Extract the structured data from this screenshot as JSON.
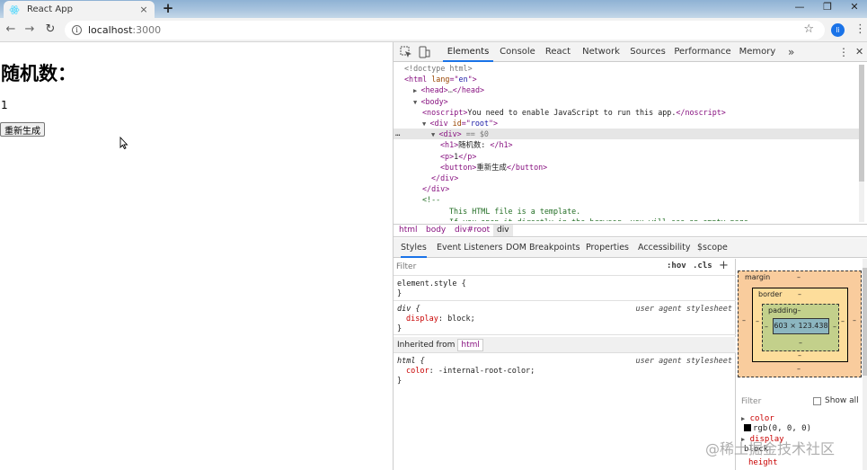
{
  "browser": {
    "tab_title": "React App",
    "tab_close": "×",
    "new_tab": "+",
    "url_host": "localhost",
    "url_port": ":3000",
    "profile_initial": "li",
    "window_controls": [
      "—",
      "❐",
      "✕"
    ],
    "nav": {
      "back": "←",
      "forward": "→",
      "reload": "↻"
    }
  },
  "page": {
    "heading": "随机数：",
    "number": "1",
    "button_label": "重新生成"
  },
  "devtools": {
    "tabs": [
      "Elements",
      "Console",
      "React",
      "Network",
      "Sources",
      "Performance",
      "Memory"
    ],
    "active_tab": "Elements",
    "more": "»",
    "menu": "⋮",
    "close": "✕",
    "dom": [
      {
        "indent": 0,
        "tri": "",
        "parts": [
          [
            "gray",
            "<!doctype html>"
          ]
        ]
      },
      {
        "indent": 0,
        "tri": "",
        "parts": [
          [
            "tag",
            "<html "
          ],
          [
            "attr",
            "lang"
          ],
          [
            "tag",
            "=\""
          ],
          [
            "val",
            "en"
          ],
          [
            "tag",
            "\">"
          ]
        ]
      },
      {
        "indent": 1,
        "tri": "▶",
        "parts": [
          [
            "tag",
            "<head>"
          ],
          [
            "gray",
            "…"
          ],
          [
            "tag",
            "</head>"
          ]
        ]
      },
      {
        "indent": 1,
        "tri": "▼",
        "parts": [
          [
            "tag",
            "<body>"
          ]
        ]
      },
      {
        "indent": 2,
        "tri": "",
        "parts": [
          [
            "tag",
            "<noscript>"
          ],
          [
            "txt",
            "You need to enable JavaScript to run this app."
          ],
          [
            "tag",
            "</noscript>"
          ]
        ]
      },
      {
        "indent": 2,
        "tri": "▼",
        "parts": [
          [
            "tag",
            "<div "
          ],
          [
            "attr",
            "id"
          ],
          [
            "tag",
            "=\""
          ],
          [
            "val",
            "root"
          ],
          [
            "tag",
            "\">"
          ]
        ]
      },
      {
        "indent": 3,
        "tri": "▼",
        "parts": [
          [
            "tag",
            "<div>"
          ],
          [
            "gray",
            " == $0"
          ]
        ]
      },
      {
        "indent": 4,
        "tri": "",
        "parts": [
          [
            "tag",
            "<h1>"
          ],
          [
            "txt",
            "随机数: "
          ],
          [
            "tag",
            "</h1>"
          ]
        ]
      },
      {
        "indent": 4,
        "tri": "",
        "parts": [
          [
            "tag",
            "<p>"
          ],
          [
            "txt",
            "1"
          ],
          [
            "tag",
            "</p>"
          ]
        ]
      },
      {
        "indent": 4,
        "tri": "",
        "parts": [
          [
            "tag",
            "<button>"
          ],
          [
            "txt",
            "重新生成"
          ],
          [
            "tag",
            "</button>"
          ]
        ]
      },
      {
        "indent": 3,
        "tri": "",
        "parts": [
          [
            "tag",
            "</div>"
          ]
        ]
      },
      {
        "indent": 2,
        "tri": "",
        "parts": [
          [
            "tag",
            "</div>"
          ]
        ]
      },
      {
        "indent": 2,
        "tri": "",
        "parts": [
          [
            "cmt",
            "<!--"
          ]
        ]
      },
      {
        "indent": 5,
        "tri": "",
        "parts": [
          [
            "cmt",
            "This HTML file is a template."
          ]
        ]
      },
      {
        "indent": 5,
        "tri": "",
        "parts": [
          [
            "cmt",
            "If you open it directly in the browser, you will see an empty page."
          ]
        ]
      }
    ],
    "selected_dom_index": 6,
    "breadcrumbs": [
      "html",
      "body",
      "div#root",
      "div"
    ],
    "styles_tabs": [
      "Styles",
      "Event Listeners",
      "DOM Breakpoints",
      "Properties",
      "Accessibility",
      "$scope"
    ],
    "styles_filter_placeholder": "Filter",
    "hov": ":hov",
    "cls": ".cls",
    "plus": "+",
    "rules": {
      "element_style_open": "element.style {",
      "element_style_close": "}",
      "div_selector": "div {",
      "div_source": "user agent stylesheet",
      "div_prop": "display",
      "div_value": ": block;",
      "div_close": "}",
      "inherited_label": "Inherited from",
      "inherited_tag": "html",
      "html_selector": "html {",
      "html_source": "user agent stylesheet",
      "html_prop": "color",
      "html_value": ": -internal-root-color;",
      "html_close": "}"
    },
    "box_model": {
      "margin_label": "margin",
      "border_label": "border",
      "padding_label": "padding–",
      "content": "603 × 123.438",
      "dash": "–"
    },
    "computed": {
      "filter_placeholder": "Filter",
      "show_all": "Show all",
      "rows": [
        {
          "name": "color",
          "value": ""
        },
        {
          "name": "",
          "value": "rgb(0, 0, 0)"
        },
        {
          "name": "display",
          "value": ""
        },
        {
          "name": "",
          "value": "block"
        },
        {
          "name": "height",
          "value": ""
        }
      ]
    }
  },
  "watermark": "@稀土掘金技术社区"
}
